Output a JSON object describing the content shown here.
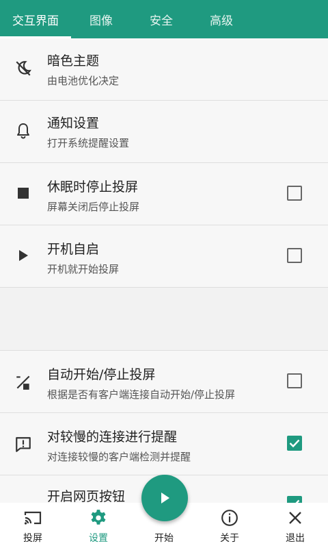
{
  "tabs": [
    {
      "label": "交互界面",
      "active": true
    },
    {
      "label": "图像",
      "active": false
    },
    {
      "label": "安全",
      "active": false
    },
    {
      "label": "高级",
      "active": false
    }
  ],
  "settings": [
    {
      "title": "暗色主题",
      "subtitle": "由电池优化决定",
      "icon": "dark-theme-icon"
    },
    {
      "title": "通知设置",
      "subtitle": "打开系统提醒设置",
      "icon": "bell-icon"
    },
    {
      "title": "休眠时停止投屏",
      "subtitle": "屏幕关闭后停止投屏",
      "icon": "stop-icon",
      "checked": false
    },
    {
      "title": "开机自启",
      "subtitle": "开机就开始投屏",
      "icon": "play-icon",
      "checked": false
    },
    {
      "title": "自动开始/停止投屏",
      "subtitle": "根据是否有客户端连接自动开始/停止投屏",
      "icon": "auto-toggle-icon",
      "checked": false
    },
    {
      "title": "对较慢的连接进行提醒",
      "subtitle": "对连接较慢的客户端检测并提醒",
      "icon": "alert-message-icon",
      "checked": true
    },
    {
      "title": "开启网页按钮",
      "icon": "web-button-icon",
      "checked": true
    }
  ],
  "bottom_nav": [
    {
      "label": "投屏",
      "icon": "cast-icon",
      "active": false
    },
    {
      "label": "设置",
      "icon": "gear-icon",
      "active": true
    },
    {
      "label": "开始",
      "icon": "play-icon",
      "active": false
    },
    {
      "label": "关于",
      "icon": "info-icon",
      "active": false
    },
    {
      "label": "退出",
      "icon": "close-icon",
      "active": false
    }
  ],
  "colors": {
    "accent": "#1f9a80",
    "background": "#f7f7f7"
  }
}
